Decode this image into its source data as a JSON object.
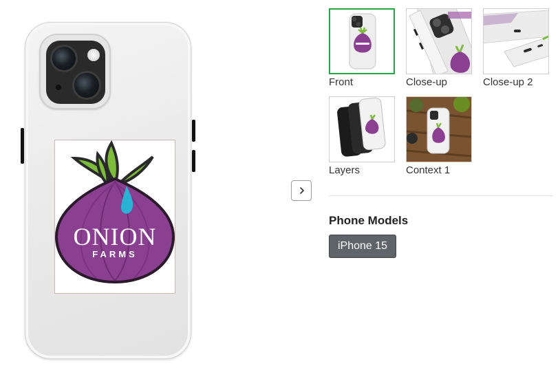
{
  "product": {
    "artwork_text": {
      "main": "ONION",
      "sub": "FARMS"
    },
    "colors": {
      "onion": "#8b3f91",
      "onion_dark": "#5c1f64",
      "leaf": "#7dbb3b",
      "drop": "#29b2d6",
      "case": "#ececec"
    }
  },
  "gallery": {
    "thumbnails": [
      {
        "label": "Front",
        "selected": true
      },
      {
        "label": "Close-up",
        "selected": false
      },
      {
        "label": "Close-up 2",
        "selected": false
      },
      {
        "label": "Layers",
        "selected": false
      },
      {
        "label": "Context 1",
        "selected": false
      }
    ],
    "next_icon": "chevron-right-icon"
  },
  "options": {
    "section_title": "Phone Models",
    "selected_model": "iPhone 15"
  },
  "theme": {
    "selected_border": "#20a845",
    "chip_bg": "#5f6468"
  }
}
